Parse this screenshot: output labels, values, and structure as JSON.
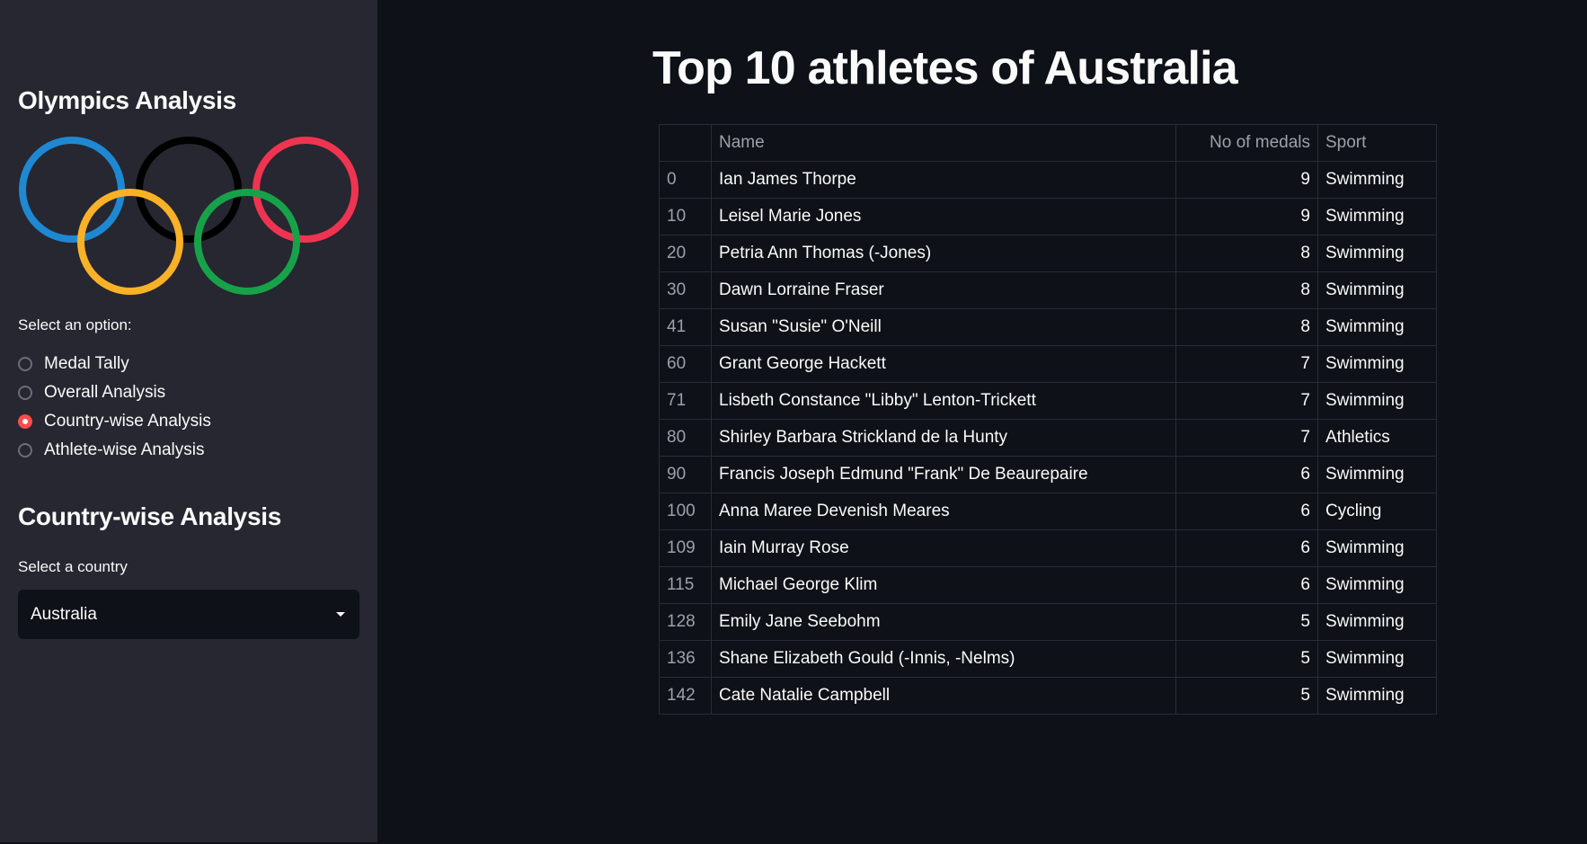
{
  "sidebar": {
    "title": "Olympics Analysis",
    "logo": {
      "icon": "olympic-rings-icon",
      "colors": [
        "#1e88d3",
        "#f9b128",
        "#000000",
        "#17a24a",
        "#ee3451"
      ]
    },
    "radio_label": "Select an option:",
    "options": [
      {
        "label": "Medal Tally",
        "checked": false
      },
      {
        "label": "Overall Analysis",
        "checked": false
      },
      {
        "label": "Country-wise Analysis",
        "checked": true
      },
      {
        "label": "Athlete-wise Analysis",
        "checked": false
      }
    ],
    "section_title": "Country-wise Analysis",
    "select_label": "Select a country",
    "select_value": "Australia"
  },
  "main": {
    "title": "Top 10 athletes of Australia",
    "table": {
      "columns": [
        "",
        "Name",
        "No of medals",
        "Sport"
      ],
      "rows": [
        {
          "index": "0",
          "name": "Ian James Thorpe",
          "medals": "9",
          "sport": "Swimming"
        },
        {
          "index": "10",
          "name": "Leisel Marie Jones",
          "medals": "9",
          "sport": "Swimming"
        },
        {
          "index": "20",
          "name": "Petria Ann Thomas (-Jones)",
          "medals": "8",
          "sport": "Swimming"
        },
        {
          "index": "30",
          "name": "Dawn Lorraine Fraser",
          "medals": "8",
          "sport": "Swimming"
        },
        {
          "index": "41",
          "name": "Susan \"Susie\" O'Neill",
          "medals": "8",
          "sport": "Swimming"
        },
        {
          "index": "60",
          "name": "Grant George Hackett",
          "medals": "7",
          "sport": "Swimming"
        },
        {
          "index": "71",
          "name": "Lisbeth Constance \"Libby\" Lenton-Trickett",
          "medals": "7",
          "sport": "Swimming"
        },
        {
          "index": "80",
          "name": "Shirley Barbara Strickland de la Hunty",
          "medals": "7",
          "sport": "Athletics"
        },
        {
          "index": "90",
          "name": "Francis Joseph Edmund \"Frank\" De Beaurepaire",
          "medals": "6",
          "sport": "Swimming"
        },
        {
          "index": "100",
          "name": "Anna Maree Devenish Meares",
          "medals": "6",
          "sport": "Cycling"
        },
        {
          "index": "109",
          "name": "Iain Murray Rose",
          "medals": "6",
          "sport": "Swimming"
        },
        {
          "index": "115",
          "name": "Michael George Klim",
          "medals": "6",
          "sport": "Swimming"
        },
        {
          "index": "128",
          "name": "Emily Jane Seebohm",
          "medals": "5",
          "sport": "Swimming"
        },
        {
          "index": "136",
          "name": "Shane Elizabeth Gould (-Innis, -Nelms)",
          "medals": "5",
          "sport": "Swimming"
        },
        {
          "index": "142",
          "name": "Cate Natalie Campbell",
          "medals": "5",
          "sport": "Swimming"
        }
      ]
    }
  },
  "colors": {
    "background": "#0e1117",
    "sidebar": "#262730",
    "accent": "#ff4b4b",
    "text": "#fafafa",
    "muted_text": "#9da0aa"
  }
}
